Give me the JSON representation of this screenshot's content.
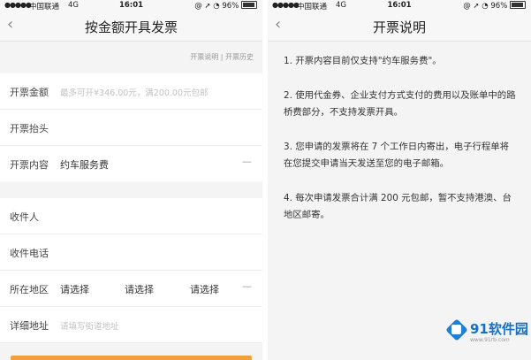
{
  "left": {
    "status": {
      "signal": "●●●●●",
      "carrier": "中国联通",
      "network": "4G",
      "time": "16:01",
      "right": "@ ➚ ◔ 96%"
    },
    "title": "按金额开具发票",
    "links": "开票说明 | 开票历史",
    "amount_label": "开票金额",
    "amount_placeholder": "最多可开¥346.00元，满200.00元包邮",
    "header_label": "开票抬头",
    "content_label": "开票内容",
    "content_value": "约车服务费",
    "content_chevron": "—",
    "recipient_label": "收件人",
    "phone_label": "收件电话",
    "region_label": "所在地区",
    "region_selects": [
      "请选择",
      "请选择",
      "请选择"
    ],
    "region_chevron": "—",
    "address_label": "详细地址",
    "address_placeholder": "请填写街道地址"
  },
  "right": {
    "status": {
      "signal": "●●●●●",
      "carrier": "中国联通",
      "network": "4G",
      "time": "16:01",
      "right": "@ ➚ ◔ 96%"
    },
    "title": "开票说明",
    "notes": [
      "1. 开票内容目前仅支持\"约车服务费\"。",
      "2. 使用代金券、企业支付方式支付的费用以及账单中的路桥费部分，不支持发票开具。",
      "3. 您申请的发票将在 7 个工作日内寄出，电子行程单将在您提交申请当天发送至您的电子邮箱。",
      "4. 每次申请发票合计满 200 元包邮，暂不支持港澳、台地区邮寄。"
    ]
  },
  "watermark": {
    "brand": "91软件园",
    "url": "www.91rb.com"
  },
  "colors": {
    "accent": "#f2a03c",
    "logo": "#1e7fd3"
  }
}
